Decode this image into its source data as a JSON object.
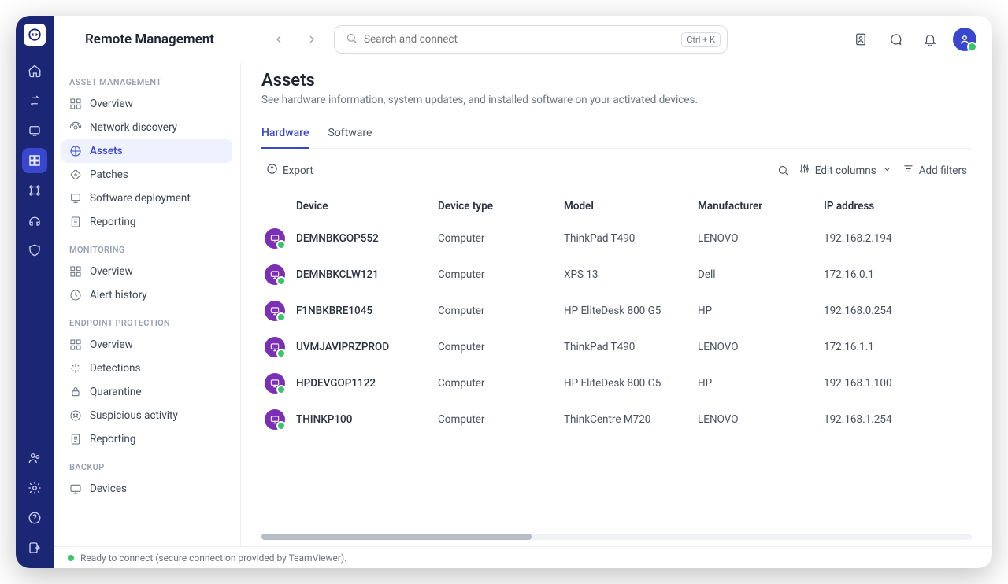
{
  "app_title": "Remote Management",
  "search": {
    "placeholder": "Search and connect",
    "shortcut": "Ctrl + K"
  },
  "sidebar": {
    "sections": [
      {
        "label": "ASSET MANAGEMENT",
        "items": [
          {
            "label": "Overview"
          },
          {
            "label": "Network discovery"
          },
          {
            "label": "Assets",
            "selected": true
          },
          {
            "label": "Patches"
          },
          {
            "label": "Software deployment"
          },
          {
            "label": "Reporting"
          }
        ]
      },
      {
        "label": "MONITORING",
        "items": [
          {
            "label": "Overview"
          },
          {
            "label": "Alert history"
          }
        ]
      },
      {
        "label": "ENDPOINT PROTECTION",
        "items": [
          {
            "label": "Overview"
          },
          {
            "label": "Detections"
          },
          {
            "label": "Quarantine"
          },
          {
            "label": "Suspicious activity"
          },
          {
            "label": "Reporting"
          }
        ]
      },
      {
        "label": "BACKUP",
        "items": [
          {
            "label": "Devices"
          }
        ]
      }
    ]
  },
  "page": {
    "title": "Assets",
    "subtitle": "See hardware information, system updates, and installed software on your activated devices."
  },
  "tabs": [
    {
      "label": "Hardware",
      "active": true
    },
    {
      "label": "Software"
    }
  ],
  "toolbar": {
    "export_label": "Export",
    "edit_columns_label": "Edit columns",
    "add_filters_label": "Add filters"
  },
  "table": {
    "columns": [
      "Device",
      "Device type",
      "Model",
      "Manufacturer",
      "IP address"
    ],
    "rows": [
      {
        "device": "DEMNBKGOP552",
        "type": "Computer",
        "model": "ThinkPad T490",
        "manufacturer": "LENOVO",
        "ip": "192.168.2.194"
      },
      {
        "device": "DEMNBKCLW121",
        "type": "Computer",
        "model": "XPS 13",
        "manufacturer": "Dell",
        "ip": "172.16.0.1"
      },
      {
        "device": "F1NBKBRE1045",
        "type": "Computer",
        "model": "HP EliteDesk 800 G5",
        "manufacturer": "HP",
        "ip": "192.168.0.254"
      },
      {
        "device": "UVMJAVIPRZPROD",
        "type": "Computer",
        "model": "ThinkPad T490",
        "manufacturer": "LENOVO",
        "ip": "172.16.1.1"
      },
      {
        "device": "HPDEVGOP1122",
        "type": "Computer",
        "model": "HP EliteDesk 800 G5",
        "manufacturer": "HP",
        "ip": "192.168.1.100"
      },
      {
        "device": "THINKP100",
        "type": "Computer",
        "model": "ThinkCentre M720",
        "manufacturer": "LENOVO",
        "ip": "192.168.1.254"
      }
    ]
  },
  "status_text": "Ready to connect (secure connection provided by TeamViewer)."
}
